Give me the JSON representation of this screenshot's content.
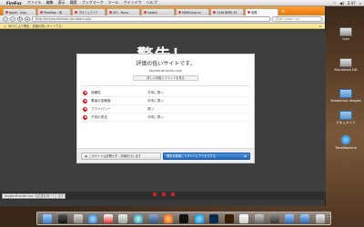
{
  "menubar": {
    "app_name": "FireFox",
    "menus": [
      "ファイル",
      "編集",
      "表示",
      "履歴",
      "ブックマーク",
      "ツール",
      "ウインドウ",
      "ヘルプ"
    ],
    "clock": "2:47"
  },
  "browser": {
    "tabs": [
      {
        "label": "Apple - Sign"
      },
      {
        "label": "PetaMap - 地"
      },
      {
        "label": "プロジェクトT"
      },
      {
        "label": "ISO - Nuno -"
      },
      {
        "label": "Coobiz"
      },
      {
        "label": "MWKCoup.co"
      },
      {
        "label": "1348 BMW 33"
      },
      {
        "label": "危険"
      }
    ],
    "url": "http://keywordtracker.com/back.php",
    "search_placeholder": "BAW classic car",
    "infobar_text": "WOTにより警告：評価の低いサイトです。",
    "infobar_close": "✕"
  },
  "warning": {
    "title": "警告！",
    "heading": "評価の低いサイトです。",
    "site": "keywordtracker.com",
    "details_button": "詳しい評価とコメントを見る",
    "ratings": [
      {
        "label": "信頼性",
        "value": "非常に悪い"
      },
      {
        "label": "業者の信頼度",
        "value": "非常に悪い"
      },
      {
        "label": "プライバシー",
        "value": "悪い"
      },
      {
        "label": "子供の安全",
        "value": "非常に悪い"
      }
    ],
    "back_button": "このサイトは訪問せず：評価を行います",
    "proceed_button": "警告を無視してサイトにアクセスする"
  },
  "status_url": "keywordtracker.com の応答を待っています...",
  "desktop_icons": [
    {
      "label": "Live",
      "kind": "disk"
    },
    {
      "label": "Macintosh HD",
      "kind": "disk"
    },
    {
      "label": "SimpleCap Images",
      "kind": "folder"
    },
    {
      "label": "ドキュメント",
      "kind": "folder"
    },
    {
      "label": "TimeMachine",
      "kind": "tm"
    }
  ],
  "colors": {
    "tabbar_orange": "#e57a10",
    "danger_red": "#d7191c",
    "proceed_blue": "#2367b8",
    "content_bg": "#3e3e3e"
  },
  "dock_icons": [
    "finder",
    "dashboard",
    "mail",
    "safari",
    "ical",
    "preview",
    "itunes",
    "iphoto",
    "firefox",
    "terminal",
    "skype",
    "photoshop",
    "illustrator",
    "textedit",
    "system-preferences",
    "calculator",
    "downloads",
    "documents",
    "trash"
  ]
}
